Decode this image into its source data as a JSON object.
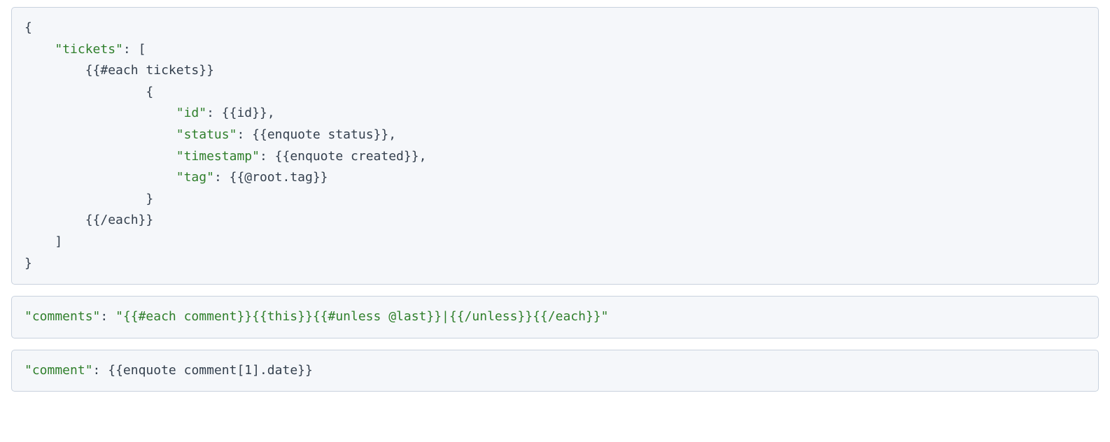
{
  "blocks": {
    "block1": {
      "line1": "{",
      "line2_indent": "    ",
      "line2_key": "\"tickets\"",
      "line2_after": ": [",
      "line3_indent": "        ",
      "line3_text": "{{#each tickets}}",
      "line4_indent": "                ",
      "line4_text": "{",
      "line5_indent": "                    ",
      "line5_key": "\"id\"",
      "line5_mid": ": ",
      "line5_val": "{{id}}",
      "line5_end": ",",
      "line6_indent": "                    ",
      "line6_key": "\"status\"",
      "line6_mid": ": ",
      "line6_val": "{{enquote status}}",
      "line6_end": ",",
      "line7_indent": "                    ",
      "line7_key": "\"timestamp\"",
      "line7_mid": ": ",
      "line7_val": "{{enquote created}}",
      "line7_end": ",",
      "line8_indent": "                    ",
      "line8_key": "\"tag\"",
      "line8_mid": ": ",
      "line8_val": "{{@root.tag}}",
      "line9_indent": "                ",
      "line9_text": "}",
      "line10_indent": "        ",
      "line10_text": "{{/each}}",
      "line11_indent": "    ",
      "line11_text": "]",
      "line12": "}"
    },
    "block2": {
      "key": "\"comments\"",
      "mid": ": ",
      "val": "\"{{#each comment}}{{this}}{{#unless @last}}|{{/unless}}{{/each}}\""
    },
    "block3": {
      "key": "\"comment\"",
      "mid": ": ",
      "val": "{{enquote comment[1].date}}"
    }
  }
}
